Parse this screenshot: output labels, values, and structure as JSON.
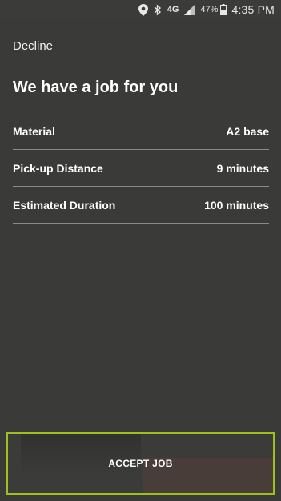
{
  "status_bar": {
    "icons": [
      "location-icon",
      "bluetooth-icon",
      "4g-lte-icon",
      "signal-icon",
      "battery-icon"
    ],
    "network": "4G",
    "battery_percent": "47%",
    "time": "4:35 PM"
  },
  "header": {
    "decline_label": "Decline",
    "title": "We have a job for you"
  },
  "details": [
    {
      "label": "Material",
      "value": "A2 base"
    },
    {
      "label": "Pick-up Distance",
      "value": "9 minutes"
    },
    {
      "label": "Estimated Duration",
      "value": "100 minutes"
    }
  ],
  "footer": {
    "accept_label": "ACCEPT JOB"
  },
  "colors": {
    "background": "#3a3a38",
    "accent": "#9fbf1e",
    "divider": "#8a8a86",
    "text": "#ffffff"
  }
}
